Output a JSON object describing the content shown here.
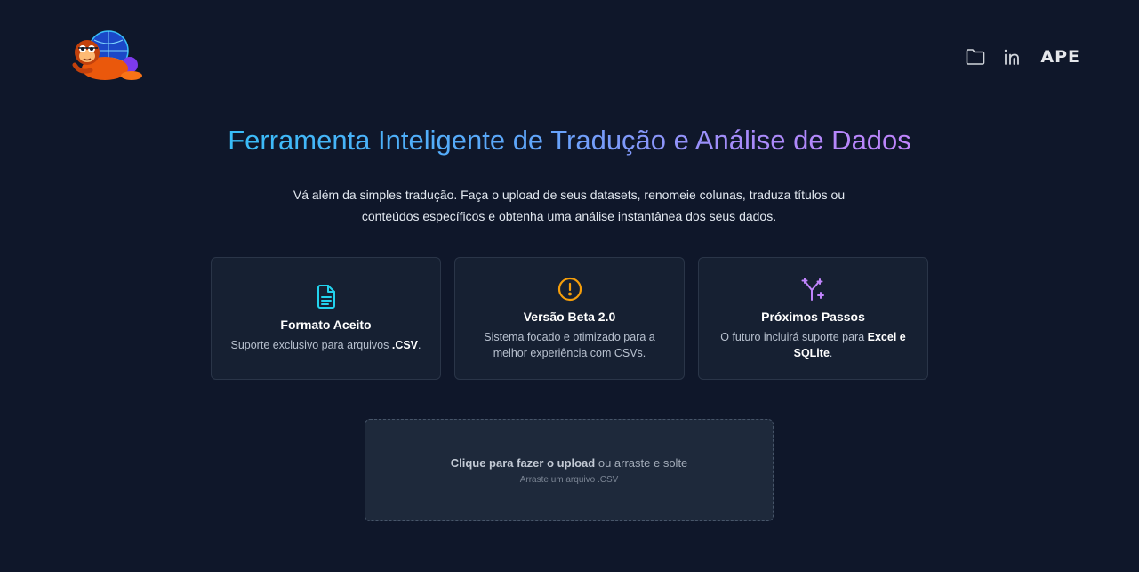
{
  "header": {
    "logo_icon": "ape-mascot-logo",
    "nav": [
      {
        "icon": "folder-icon"
      },
      {
        "icon": "linkedin-icon"
      },
      {
        "label": "APE"
      }
    ]
  },
  "hero": {
    "title": "Ferramenta Inteligente de Tradução e Análise de Dados",
    "subtitle": "Vá além da simples tradução. Faça o upload de seus datasets, renomeie colunas, traduza títulos ou conteúdos específicos e obtenha uma análise instantânea dos seus dados."
  },
  "cards": [
    {
      "icon": "document-icon",
      "icon_color": "#22d3ee",
      "title": "Formato Aceito",
      "text_before": "Suporte exclusivo para arquivos ",
      "text_bold": ".CSV",
      "text_after": "."
    },
    {
      "icon": "alert-circle-icon",
      "icon_color": "#f59e0b",
      "title": "Versão Beta 2.0",
      "text_before": "Sistema focado e otimizado para a melhor experiência com CSVs.",
      "text_bold": "",
      "text_after": ""
    },
    {
      "icon": "branch-sparkle-icon",
      "icon_color": "#c084fc",
      "title": "Próximos Passos",
      "text_before": "O futuro incluirá suporte para ",
      "text_bold": "Excel e SQLite",
      "text_after": "."
    }
  ],
  "upload": {
    "action_label": "Clique para fazer o upload",
    "rest_label": " ou arraste e solte",
    "hint": "Arraste um arquivo .CSV"
  },
  "colors": {
    "background": "#0f172a",
    "card_bg": "#162032",
    "upload_bg": "#1e293b",
    "title_gradient_start": "#38bdf8",
    "title_gradient_end": "#c084fc"
  }
}
